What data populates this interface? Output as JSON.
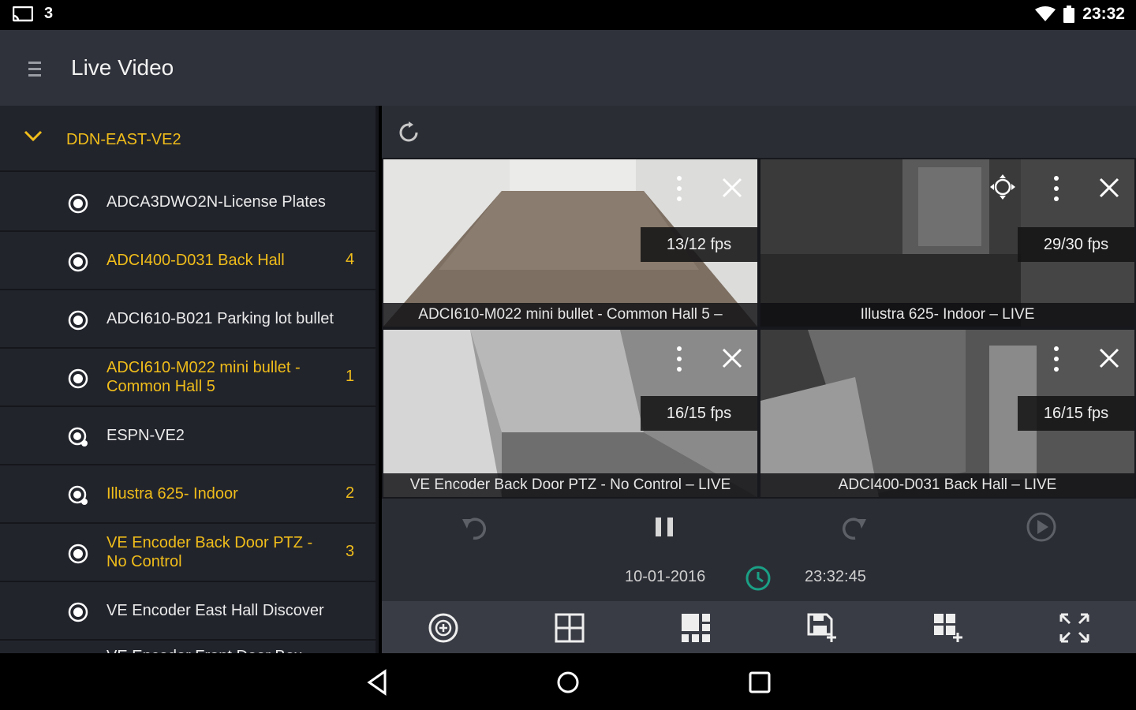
{
  "status_bar": {
    "notification": "3",
    "time": "23:32"
  },
  "app_bar": {
    "title": "Live Video"
  },
  "sidebar": {
    "group": "DDN-EAST-VE2",
    "items": [
      {
        "name": "ADCA3DWO2N-License Plates",
        "active": false,
        "count": ""
      },
      {
        "name": "ADCI400-D031 Back Hall",
        "active": true,
        "count": "4"
      },
      {
        "name": "ADCI610-B021 Parking lot bullet",
        "active": false,
        "count": ""
      },
      {
        "name": "ADCI610-M022 mini bullet - Common Hall 5",
        "active": true,
        "count": "1"
      },
      {
        "name": "ESPN-VE2",
        "active": false,
        "count": ""
      },
      {
        "name": "Illustra 625- Indoor",
        "active": true,
        "count": "2"
      },
      {
        "name": "VE Encoder Back Door PTZ - No Control",
        "active": true,
        "count": "3"
      },
      {
        "name": "VE Encoder East Hall Discover",
        "active": false,
        "count": ""
      },
      {
        "name": "VE Encoder Front Door Box",
        "active": false,
        "count": ""
      }
    ]
  },
  "tiles": [
    {
      "caption": "ADCI610-M022 mini bullet - Common Hall 5 –",
      "fps": "13/12 fps"
    },
    {
      "caption": "Illustra 625- Indoor – LIVE",
      "fps": "29/30 fps"
    },
    {
      "caption": "VE Encoder Back Door PTZ - No Control – LIVE",
      "fps": "16/15 fps"
    },
    {
      "caption": "ADCI400-D031 Back Hall – LIVE",
      "fps": "16/15 fps"
    }
  ],
  "playback": {
    "date": "10-01-2016",
    "time": "23:32:45"
  },
  "colors": {
    "accent": "#f0bd1a",
    "clock": "#1aa085"
  }
}
